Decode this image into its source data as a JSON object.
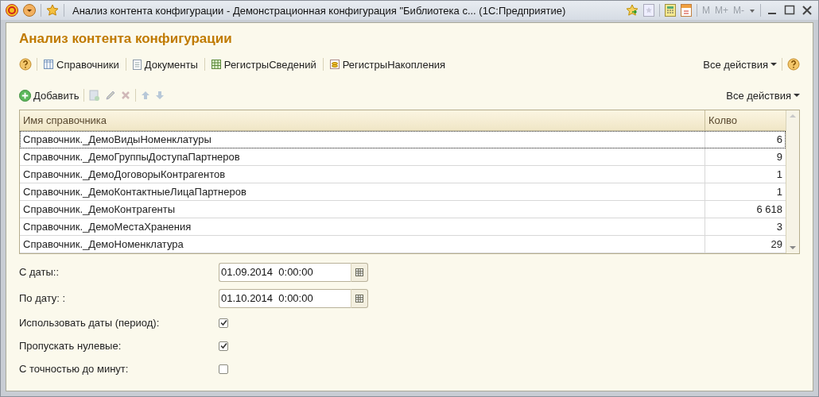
{
  "window": {
    "title": "Анализ контента конфигурации - Демонстрационная конфигурация \"Библиотека с... (1С:Предприятие)",
    "memory_buttons": [
      "M",
      "M+",
      "M-"
    ]
  },
  "form_title": "Анализ контента конфигурации",
  "command_bar": {
    "items": [
      {
        "label": "Справочники",
        "kind": "catalog"
      },
      {
        "label": "Документы",
        "kind": "document"
      },
      {
        "label": "РегистрыСведений",
        "kind": "info"
      },
      {
        "label": "РегистрыНакопления",
        "kind": "accum"
      }
    ],
    "all_actions": "Все действия"
  },
  "table_toolbar": {
    "add": "Добавить",
    "all_actions": "Все действия"
  },
  "table": {
    "columns": [
      "Имя справочника",
      "Колво"
    ],
    "rows": [
      {
        "name": "Справочник._ДемоВидыНоменклатуры",
        "count": "6",
        "selected": true
      },
      {
        "name": "Справочник._ДемоГруппыДоступаПартнеров",
        "count": "9",
        "selected": false
      },
      {
        "name": "Справочник._ДемоДоговорыКонтрагентов",
        "count": "1",
        "selected": false
      },
      {
        "name": "Справочник._ДемоКонтактныеЛицаПартнеров",
        "count": "1",
        "selected": false
      },
      {
        "name": "Справочник._ДемоКонтрагенты",
        "count": "6 618",
        "selected": false
      },
      {
        "name": "Справочник._ДемоМестаХранения",
        "count": "3",
        "selected": false
      },
      {
        "name": "Справочник._ДемоНоменклатура",
        "count": "29",
        "selected": false
      }
    ]
  },
  "fields": [
    {
      "kind": "date",
      "label": "С даты::",
      "value": "01.09.2014  0:00:00"
    },
    {
      "kind": "date",
      "label": "По дату: :",
      "value": "01.10.2014  0:00:00"
    },
    {
      "kind": "checkbox",
      "label": "Использовать даты (период):",
      "checked": true
    },
    {
      "kind": "checkbox",
      "label": "Пропускать нулевые:",
      "checked": true
    },
    {
      "kind": "checkbox",
      "label": "С точностью до минут:",
      "checked": false
    }
  ]
}
